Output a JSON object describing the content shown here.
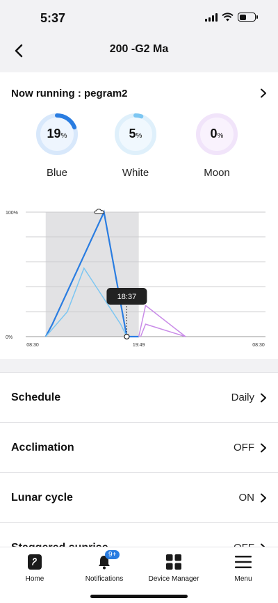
{
  "status_bar": {
    "time": "5:37",
    "battery_level": 0.45
  },
  "header": {
    "title": "200 -G2 Ma"
  },
  "running": {
    "label": "Now running : pegram2"
  },
  "channels": [
    {
      "name": "Blue",
      "value": "19",
      "unit": "%",
      "level": 0.19,
      "color": "#2a7de1",
      "track": "#d8e8fb",
      "bg": "#eef5fe"
    },
    {
      "name": "White",
      "value": "5",
      "unit": "%",
      "level": 0.05,
      "color": "#7cc6f2",
      "track": "#dff0fb",
      "bg": "#f0f8fe"
    },
    {
      "name": "Moon",
      "value": "0",
      "unit": "%",
      "level": 0.0,
      "color": "#c98be8",
      "track": "#f1e4fa",
      "bg": "#f9f2fd"
    }
  ],
  "chart_data": {
    "type": "line",
    "y_tick_labels": [
      "100%",
      "0%"
    ],
    "x_tick_labels": [
      "08:30",
      "19:49",
      "08:30"
    ],
    "tooltip": "18:37",
    "x_range": [
      "08:30",
      "08:30 (+1 day)"
    ],
    "ylim": [
      0,
      100
    ],
    "grid": true,
    "series": [
      {
        "color": "#2a7de1",
        "points": [
          [
            "10:30",
            0
          ],
          [
            "11:10",
            10
          ],
          [
            "16:20",
            100
          ],
          [
            "18:37",
            0
          ],
          [
            "19:49",
            0
          ]
        ]
      },
      {
        "color": "#7cc6f2",
        "points": [
          [
            "10:30",
            0
          ],
          [
            "12:40",
            20
          ],
          [
            "14:20",
            55
          ],
          [
            "18:00",
            10
          ],
          [
            "18:37",
            0
          ]
        ]
      },
      {
        "color": "#c98be8",
        "points": [
          [
            "19:49",
            0
          ],
          [
            "20:30",
            25
          ],
          [
            "24:30",
            0
          ],
          [
            "20:30",
            10
          ],
          [
            "20:00",
            0
          ]
        ]
      }
    ],
    "shaded_period": [
      "10:30",
      "19:49"
    ],
    "cloud_icon": "cloud-icon"
  },
  "settings": [
    {
      "label": "Schedule",
      "value": "Daily"
    },
    {
      "label": "Acclimation",
      "value": "OFF"
    },
    {
      "label": "Lunar cycle",
      "value": "ON"
    },
    {
      "label": "Staggered sunrise",
      "value": "OFF"
    }
  ],
  "tabs": [
    {
      "label": "Home",
      "icon": "home-icon"
    },
    {
      "label": "Notifications",
      "icon": "bell-icon",
      "badge": "9+"
    },
    {
      "label": "Device Manager",
      "icon": "grid-icon"
    },
    {
      "label": "Menu",
      "icon": "menu-icon"
    }
  ],
  "colors": {
    "accent": "#2a7de1",
    "moon": "#c98be8",
    "white": "#7cc6f2"
  }
}
